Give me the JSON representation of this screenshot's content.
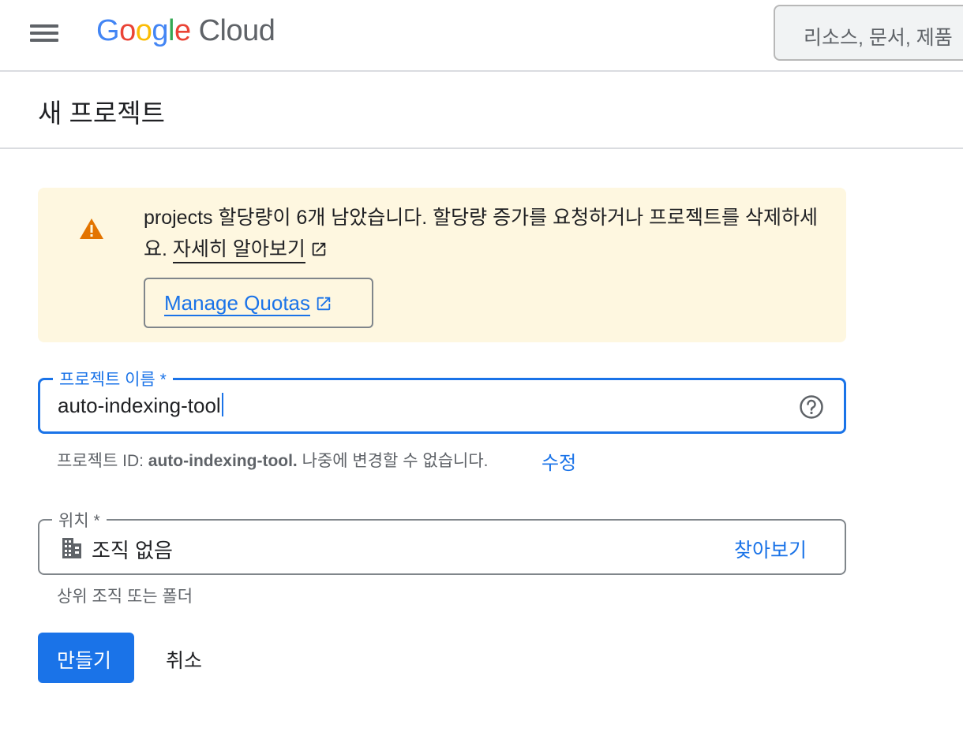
{
  "header": {
    "logo_google_letters": [
      "G",
      "o",
      "o",
      "g",
      "l",
      "e"
    ],
    "logo_google_colors": [
      "#4285F4",
      "#EA4335",
      "#FBBC05",
      "#4285F4",
      "#34A853",
      "#EA4335"
    ],
    "logo_cloud": "Cloud",
    "search_placeholder": "리소스, 문서, 제품"
  },
  "page": {
    "title": "새 프로젝트"
  },
  "banner": {
    "message": "projects 할당량이 6개 남았습니다. 할당량 증가를 요청하거나 프로젝트를 삭제하세요.",
    "learn_more": "자세히 알아보기",
    "manage_quotas": "Manage Quotas",
    "icon": "warning-icon",
    "background": "#fef7e0",
    "icon_color": "#e37400"
  },
  "project_name": {
    "label": "프로젝트 이름 *",
    "value": "auto-indexing-tool",
    "help_icon": "help-icon"
  },
  "project_id": {
    "prefix": "프로젝트 ID:",
    "id": "auto-indexing-tool.",
    "suffix": "나중에 변경할 수 없습니다.",
    "edit": "수정"
  },
  "location": {
    "label": "위치 *",
    "value": "조직 없음",
    "browse": "찾아보기",
    "helper": "상위 조직 또는 폴더",
    "icon": "building-icon"
  },
  "actions": {
    "create": "만들기",
    "cancel": "취소"
  },
  "colors": {
    "accent": "#1a73e8"
  }
}
